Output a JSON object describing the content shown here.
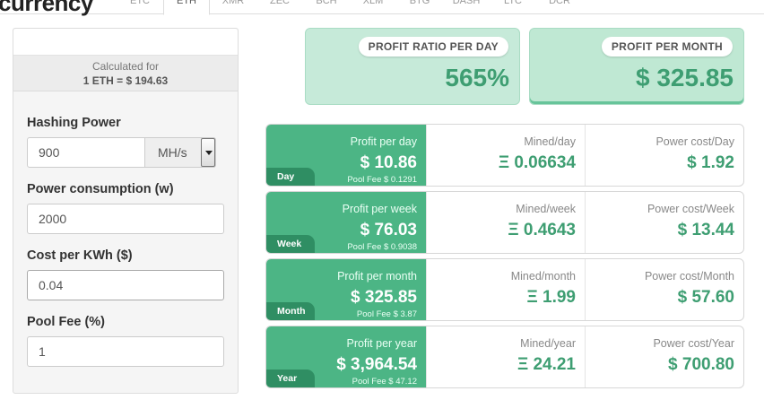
{
  "header": {
    "brand": "currency",
    "tabs": [
      "ETC",
      "ETH",
      "XMR",
      "ZEC",
      "BCH",
      "XLM",
      "BTG",
      "DASH",
      "LTC",
      "DCR"
    ],
    "active_tab": "ETH"
  },
  "calculator": {
    "calculated_for_label": "Calculated for",
    "rate": "1 ETH = $ 194.63",
    "hashing_power_label": "Hashing Power",
    "hashing_power_value": "900",
    "hashing_unit": "MH/s",
    "power_label": "Power consumption (w)",
    "power_value": "2000",
    "cost_label": "Cost per KWh ($)",
    "cost_value": "0.04",
    "pool_fee_label": "Pool Fee (%)",
    "pool_fee_value": "1"
  },
  "summary": {
    "ratio_label": "PROFIT RATIO PER DAY",
    "ratio_value": "565%",
    "month_label": "PROFIT PER MONTH",
    "month_value": "$ 325.85"
  },
  "rows": [
    {
      "tag": "Day",
      "profit_label": "Profit per day",
      "profit": "$ 10.86",
      "pool_fee": "Pool Fee $ 0.1291",
      "mined_label": "Mined/day",
      "mined": "Ξ 0.06634",
      "power_label": "Power cost/Day",
      "power": "$ 1.92"
    },
    {
      "tag": "Week",
      "profit_label": "Profit per week",
      "profit": "$ 76.03",
      "pool_fee": "Pool Fee $ 0.9038",
      "mined_label": "Mined/week",
      "mined": "Ξ 0.4643",
      "power_label": "Power cost/Week",
      "power": "$ 13.44"
    },
    {
      "tag": "Month",
      "profit_label": "Profit per month",
      "profit": "$ 325.85",
      "pool_fee": "Pool Fee $ 3.87",
      "mined_label": "Mined/month",
      "mined": "Ξ 1.99",
      "power_label": "Power cost/Month",
      "power": "$ 57.60"
    },
    {
      "tag": "Year",
      "profit_label": "Profit per year",
      "profit": "$ 3,964.54",
      "pool_fee": "Pool Fee $ 47.12",
      "mined_label": "Mined/year",
      "mined": "Ξ 24.21",
      "power_label": "Power cost/Year",
      "power": "$ 700.80"
    }
  ]
}
